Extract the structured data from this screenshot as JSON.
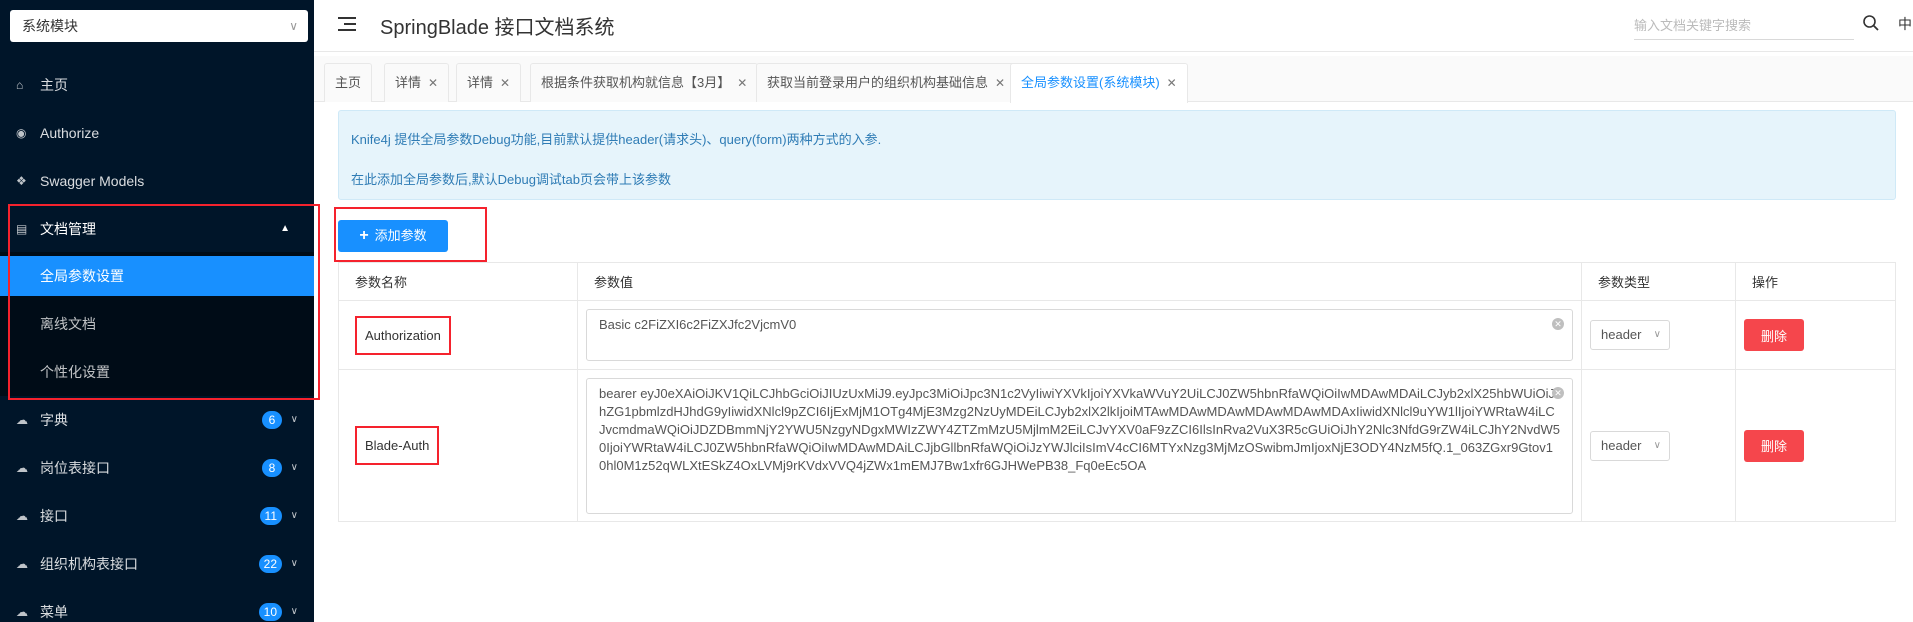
{
  "sidebar": {
    "module_select": "系统模块",
    "menu": {
      "home": "主页",
      "authorize": "Authorize",
      "swagger_models": "Swagger Models",
      "doc_manage": "文档管理",
      "dict": "字典",
      "post_api": "岗位表接口",
      "api": "接口",
      "org_api": "组织机构表接口",
      "menu": "菜单"
    },
    "submenu": {
      "global_params": "全局参数设置",
      "offline_docs": "离线文档",
      "personal_settings": "个性化设置"
    },
    "badges": {
      "dict": "6",
      "post_api": "8",
      "api": "11",
      "org_api": "22",
      "menu": "10"
    }
  },
  "header": {
    "title": "SpringBlade 接口文档系统",
    "search_placeholder": "输入文档关键字搜索",
    "lang": "中"
  },
  "tabs": [
    {
      "label": "主页"
    },
    {
      "label": "详情"
    },
    {
      "label": "详情"
    },
    {
      "label": "根据条件获取机构就信息【3月】"
    },
    {
      "label": "获取当前登录用户的组织机构基础信息"
    },
    {
      "label": "全局参数设置(系统模块)"
    }
  ],
  "alert": {
    "line1": "Knife4j 提供全局参数Debug功能,目前默认提供header(请求头)、query(form)两种方式的入参.",
    "line2": "在此添加全局参数后,默认Debug调试tab页会带上该参数"
  },
  "add_button": "添加参数",
  "table": {
    "headers": {
      "name": "参数名称",
      "value": "参数值",
      "type": "参数类型",
      "action": "操作"
    },
    "rows": [
      {
        "name": "Authorization",
        "value": "Basic c2FiZXI6c2FiZXJfc2VjcmV0",
        "type": "header",
        "action": "删除"
      },
      {
        "name": "Blade-Auth",
        "value": "bearer eyJ0eXAiOiJKV1QiLCJhbGciOiJIUzUxMiJ9.eyJpc3MiOiJpc3N1c2VyIiwiYXVkIjoiYXVkaWVuY2UiLCJ0ZW5hbnRfaWQiOiIwMDAwMDAiLCJyb2xlX25hbWUiOiJhZG1pbmlzdHJhdG9yIiwidXNlcl9pZCI6IjExMjM1OTg4MjE3Mzg2NzUyMDEiLCJyb2xlX2lkIjoiMTAwMDAwMDAwMDAwMDAwMDAxIiwidXNlcl9uYW1lIjoiYWRtaW4iLCJvcmdmaWQiOiJDZDBmmNjY2YWU5NzgyNDgxMWIzZWY4ZTZmMzU5MjlmM2EiLCJvYXV0aF9zZCI6IlsInRva2VuX3R5cGUiOiJhY2Nlc3NfdG9rZW4iLCJhY2NvdW50IjoiYWRtaW4iLCJ0ZW5hbnRfaWQiOiIwMDAwMDAiLCJjbGllbnRfaWQiOiJzYWJlciIsImV4cCI6MTYxNzg3MjMzOSwibmJmIjoxNjE3ODY4NzM5fQ.1_063ZGxr9Gtov10hl0M1z52qWLXtESkZ4OxLVMj9rKVdxVVQ4jZWx1mEMJ7Bw1xfr6GJHWePB38_Fq0eEc5OA",
        "type": "header",
        "action": "删除"
      }
    ]
  }
}
